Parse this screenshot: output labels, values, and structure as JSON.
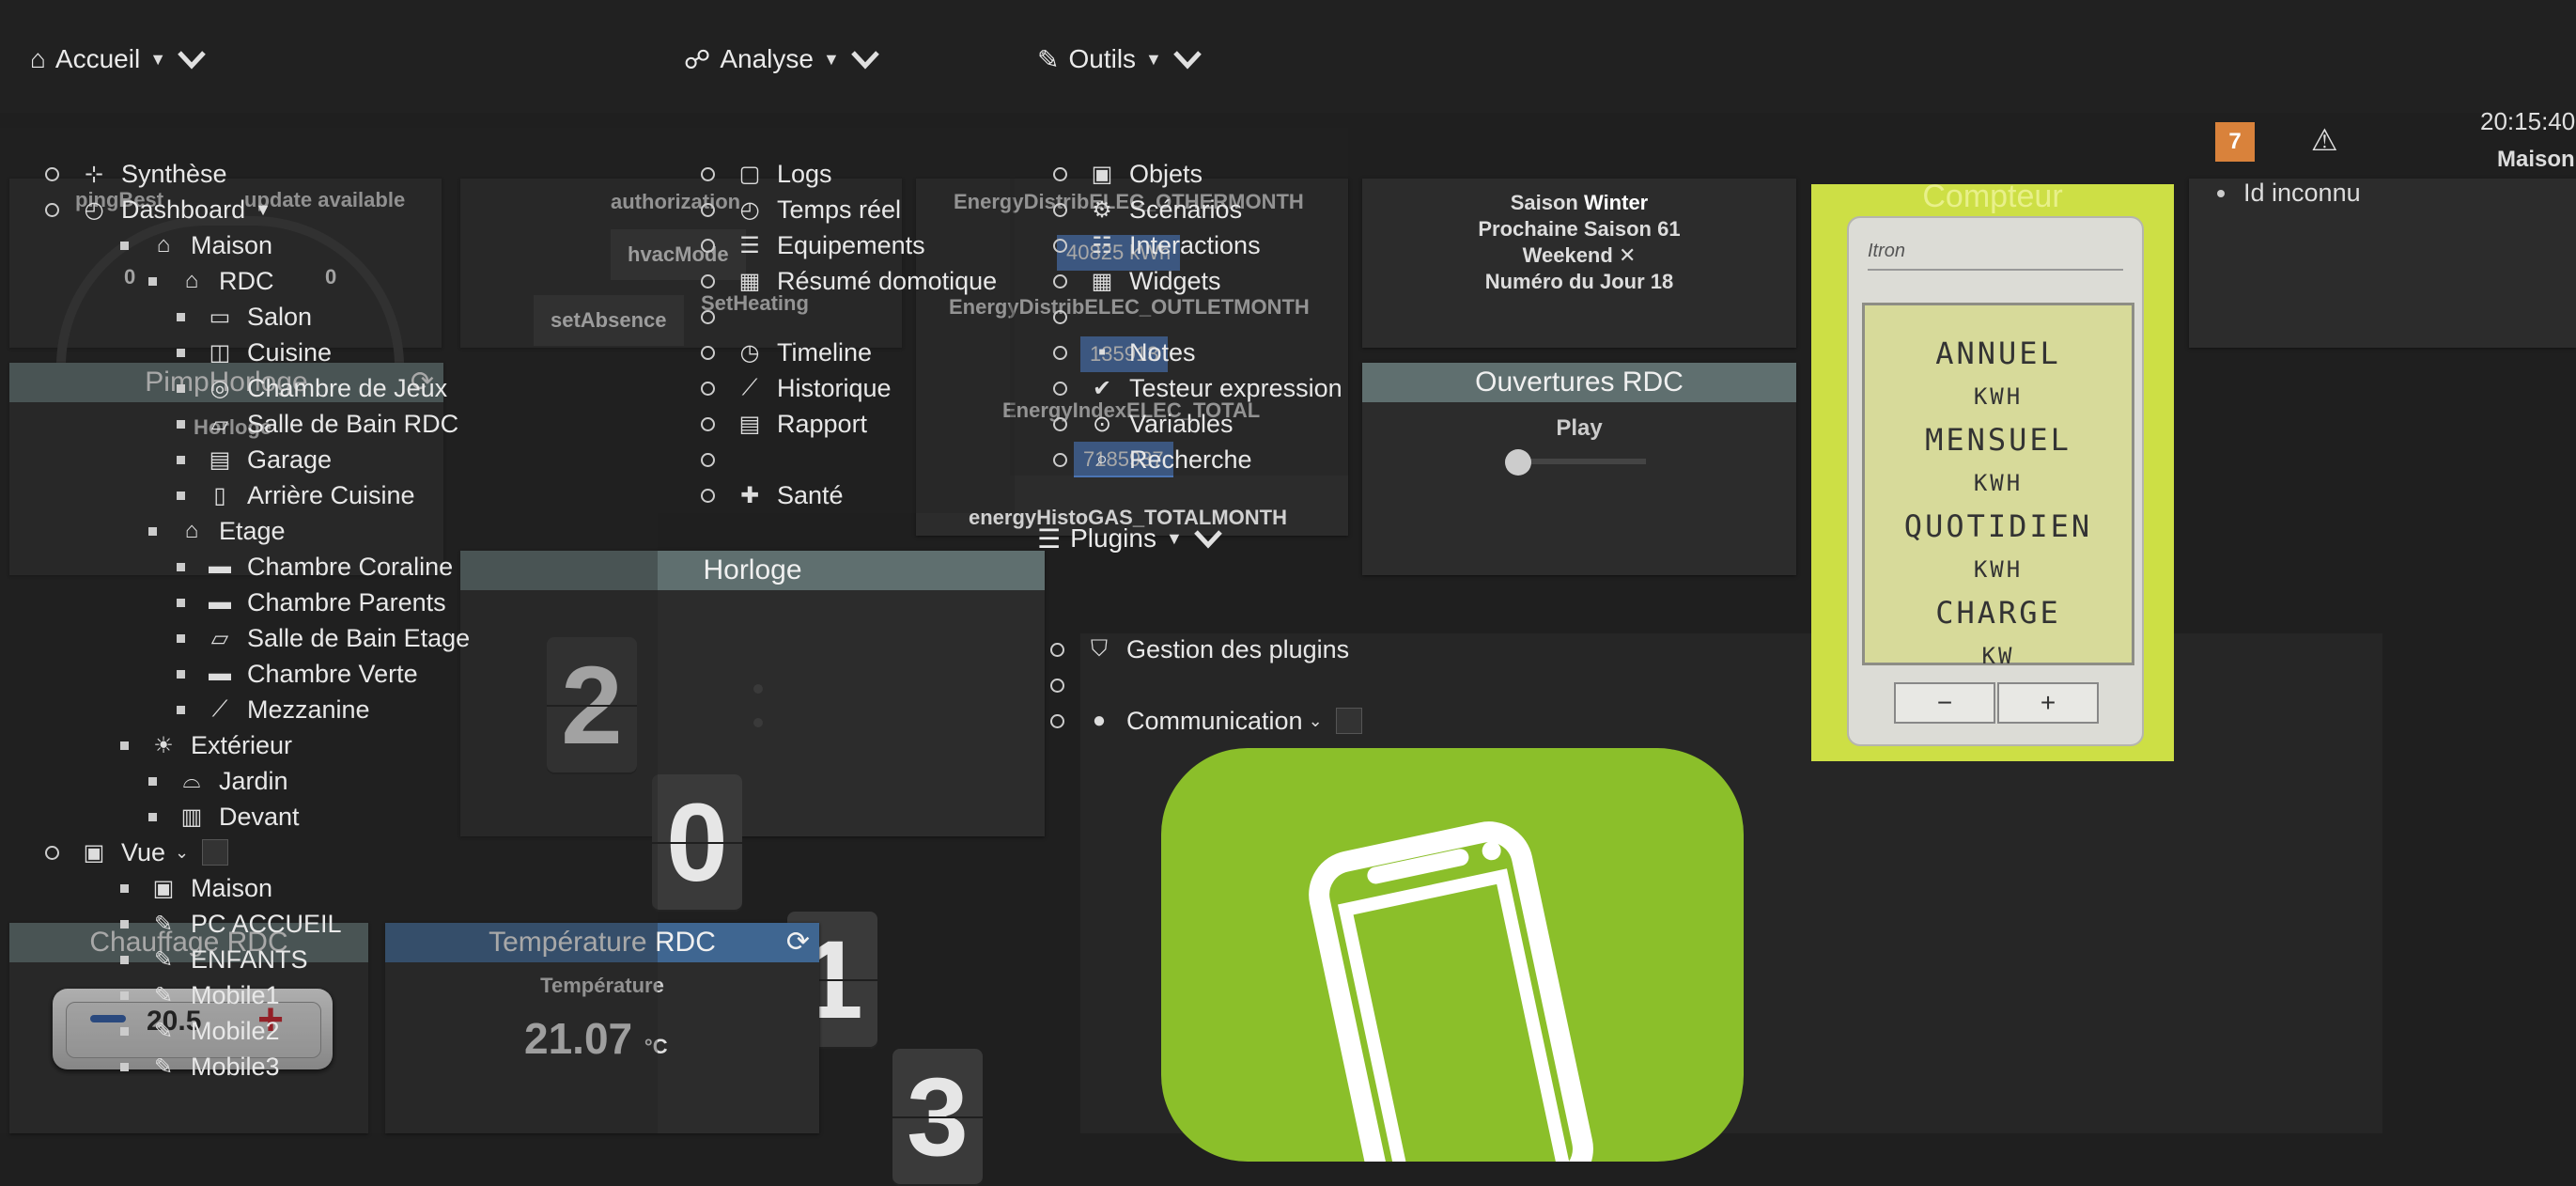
{
  "nav": {
    "home": "Accueil",
    "analyse": "Analyse",
    "outils": "Outils",
    "plugins": "Plugins"
  },
  "header": {
    "badge_count": "7",
    "time": "20:15:40",
    "maison": "Maison",
    "id_inconnu": "Id inconnu"
  },
  "accueil_menu": {
    "synthese": "Synthèse",
    "dashboard": "Dashboard",
    "rooms": [
      {
        "label": "Maison",
        "level": 1,
        "icon": "house-icon",
        "glyph": "⌂"
      },
      {
        "label": "RDC",
        "level": 2,
        "icon": "house-icon",
        "glyph": "⌂"
      },
      {
        "label": "Salon",
        "level": 3,
        "icon": "sofa-icon",
        "glyph": "▭"
      },
      {
        "label": "Cuisine",
        "level": 3,
        "icon": "kitchen-icon",
        "glyph": "◫"
      },
      {
        "label": "Chambre de Jeux",
        "level": 3,
        "icon": "gamepad-icon",
        "glyph": "◎"
      },
      {
        "label": "Salle de Bain RDC",
        "level": 3,
        "icon": "bathtub-icon",
        "glyph": "▱"
      },
      {
        "label": "Garage",
        "level": 3,
        "icon": "garage-icon",
        "glyph": "▤"
      },
      {
        "label": "Arrière Cuisine",
        "level": 3,
        "icon": "trash-icon",
        "glyph": "▯"
      },
      {
        "label": "Etage",
        "level": 2,
        "icon": "house-icon",
        "glyph": "⌂"
      },
      {
        "label": "Chambre Coraline",
        "level": 3,
        "icon": "bed-icon",
        "glyph": "▬"
      },
      {
        "label": "Chambre Parents",
        "level": 3,
        "icon": "bed-icon",
        "glyph": "▬"
      },
      {
        "label": "Salle de Bain Etage",
        "level": 3,
        "icon": "bathtub-icon",
        "glyph": "▱"
      },
      {
        "label": "Chambre Verte",
        "level": 3,
        "icon": "bed-icon",
        "glyph": "▬"
      },
      {
        "label": "Mezzanine",
        "level": 3,
        "icon": "stairs-icon",
        "glyph": "⟋"
      },
      {
        "label": "Extérieur",
        "level": 1,
        "icon": "sun-icon",
        "glyph": "☀"
      },
      {
        "label": "Jardin",
        "level": 2,
        "icon": "bbq-icon",
        "glyph": "⌓"
      },
      {
        "label": "Devant",
        "level": 2,
        "icon": "gate-icon",
        "glyph": "▥"
      }
    ],
    "vue": "Vue",
    "vue_items": [
      {
        "label": "Maison",
        "icon": "image-icon"
      },
      {
        "label": "PC ACCUEIL",
        "icon": "brush-icon"
      },
      {
        "label": "ENFANTS",
        "icon": "brush-icon"
      },
      {
        "label": "Mobile1",
        "icon": "brush-icon"
      },
      {
        "label": "Mobile2",
        "icon": "brush-icon"
      },
      {
        "label": "Mobile3",
        "icon": "brush-icon"
      }
    ]
  },
  "analyse_menu": {
    "items": [
      "Logs",
      "Temps réel",
      "Equipements",
      "Résumé domotique",
      "",
      "Timeline",
      "Historique",
      "Rapport",
      "",
      "Santé"
    ]
  },
  "outils_menu": {
    "items": [
      "Objets",
      "Scénarios",
      "Interactions",
      "Widgets",
      "",
      "Notes",
      "Testeur expression",
      "Variables",
      "Recherche"
    ]
  },
  "plugins_menu": {
    "gestion": "Gestion des plugins",
    "communication": "Communication"
  },
  "widgets": {
    "pingbest": {
      "title": "pingBest",
      "update": "update available",
      "left": "0",
      "right": "0"
    },
    "authorization": "authorization",
    "hvac": "hvacMode",
    "setabsence": "setAbsence",
    "setheating": "SetHeating",
    "energy1": {
      "label": "EnergyDistribELEC_OTHERMONTH",
      "value": "40825 kWh"
    },
    "energy2": {
      "label": "EnergyDistribELEC_OUTLETMONTH",
      "value": "135913"
    },
    "energy3": {
      "label": "EnergyIndexELEC_TOTAL",
      "value": "7185937"
    },
    "energy4": {
      "label": "energyHistoGAS_TOTALMONTH"
    },
    "saison": {
      "saison_lbl": "Saison",
      "saison_val": "Winter",
      "prochaine_lbl": "Prochaine Saison",
      "prochaine_val": "61",
      "weekend_lbl": "Weekend",
      "weekend_val": "✕",
      "jour_lbl": "Numéro du Jour",
      "jour_val": "18"
    },
    "pimphorloge": {
      "title": "PimpHorloge",
      "sub": "Horloge"
    },
    "ouvertures": {
      "title": "Ouvertures RDC",
      "play": "Play"
    },
    "horloge": {
      "title": "Horloge",
      "digits": [
        "2",
        "0",
        "1",
        "3"
      ]
    },
    "chauffage": {
      "title": "Chauffage RDC",
      "setpoint": "20.5"
    },
    "temperature": {
      "title": "Température RDC",
      "label": "Température",
      "value": "21.07",
      "unit": "°C"
    },
    "compteur": {
      "title": "Compteur",
      "lines": [
        "ANNUEL",
        "KWH",
        "MENSUEL",
        "KWH",
        "QUOTIDIEN",
        "KWH",
        "CHARGE",
        "KW"
      ],
      "brand": "Itron",
      "minus": "−",
      "plus": "+"
    }
  },
  "colors": {
    "accent_green": "#8bbf2a",
    "counter_green": "#cddf45",
    "badge_orange": "#d9823b",
    "title_grey": "#5f6f6f",
    "title_blue": "#3f6691"
  }
}
